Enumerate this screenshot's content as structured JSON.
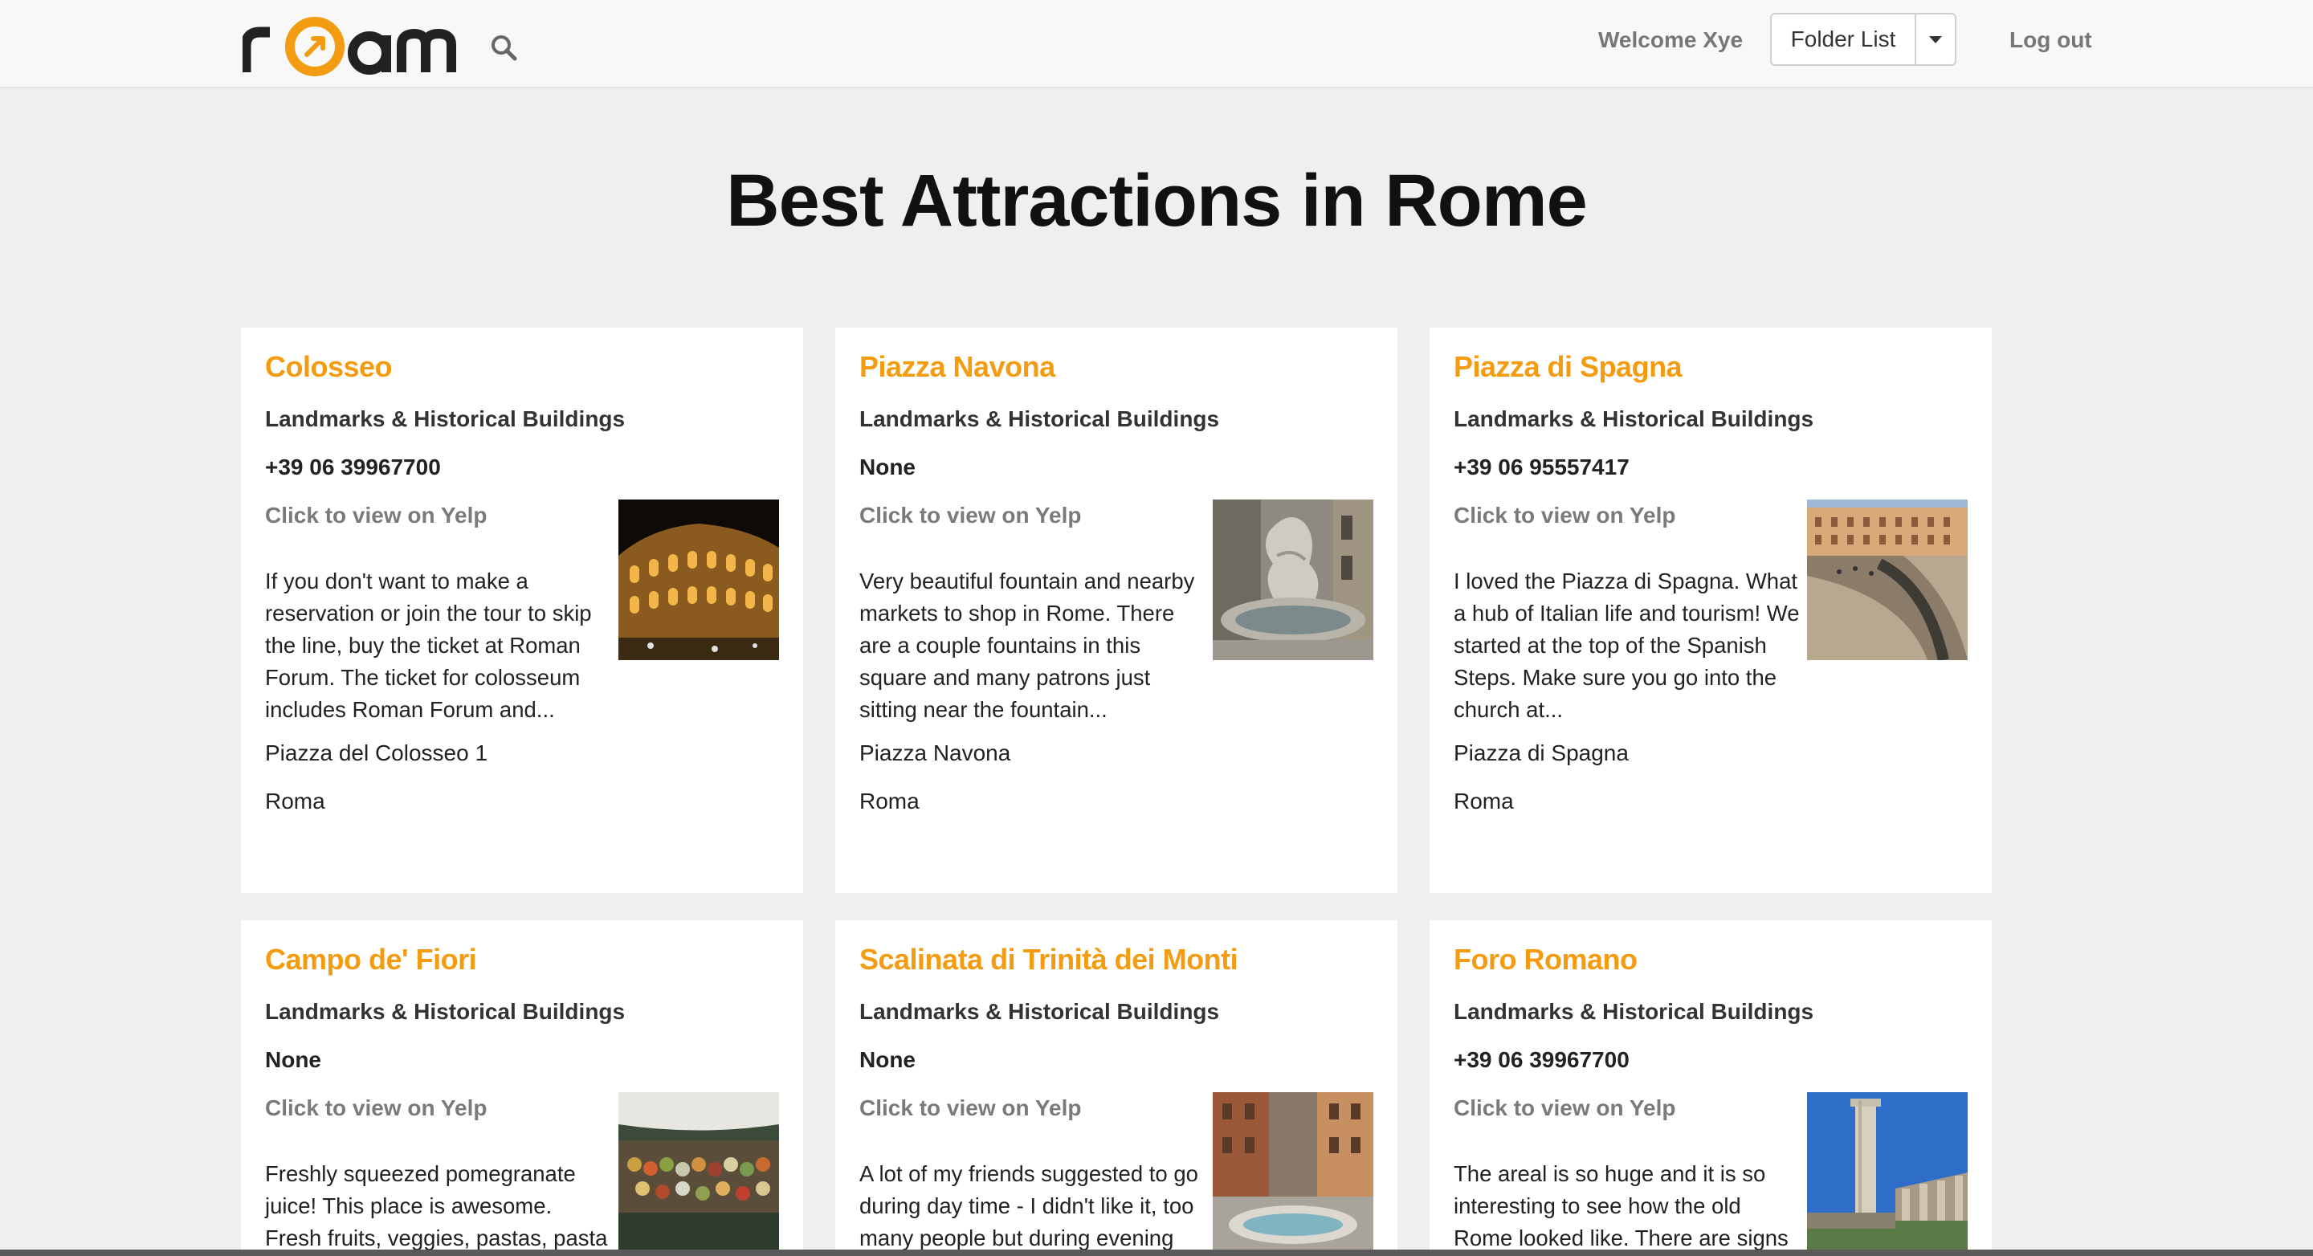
{
  "header": {
    "brand": "roam",
    "welcome": "Welcome Xye",
    "folder_list_label": "Folder List",
    "logout_label": "Log out"
  },
  "page_title": "Best Attractions in Rome",
  "colors": {
    "accent": "#f39c12",
    "background": "#efefef",
    "navbar": "#f8f8f8"
  },
  "cards": [
    {
      "name": "Colosseo",
      "category": "Landmarks & Historical Buildings",
      "phone": "+39 06 39967700",
      "yelp_link": "Click to view on Yelp",
      "review": "If you don't want to make a reservation or join the tour to skip the line, buy the ticket at Roman Forum. The ticket for colosseum includes Roman Forum and...",
      "address": "Piazza del Colosseo 1",
      "city": "Roma",
      "image": "colosseum-photo"
    },
    {
      "name": "Piazza Navona",
      "category": "Landmarks & Historical Buildings",
      "phone": "None",
      "yelp_link": "Click to view on Yelp",
      "review": "Very beautiful fountain and nearby markets to shop in Rome. There are a couple fountains in this square and many patrons just sitting near the fountain...",
      "address": "Piazza Navona",
      "city": "Roma",
      "image": "fountain-statue-photo"
    },
    {
      "name": "Piazza di Spagna",
      "category": "Landmarks & Historical Buildings",
      "phone": "+39 06 95557417",
      "yelp_link": "Click to view on Yelp",
      "review": "I loved the Piazza di Spagna. What a hub of Italian life and tourism! We started at the top of the Spanish Steps. Make sure you go into the church at...",
      "address": "Piazza di Spagna",
      "city": "Roma",
      "image": "piazza-steps-photo"
    },
    {
      "name": "Campo de' Fiori",
      "category": "Landmarks & Historical Buildings",
      "phone": "None",
      "yelp_link": "Click to view on Yelp",
      "review": "Freshly squeezed pomegranate juice! This place is awesome. Fresh fruits, veggies, pastas, pasta sauces,",
      "address": "",
      "city": "",
      "image": "market-stall-photo"
    },
    {
      "name": "Scalinata di Trinità dei Monti",
      "category": "Landmarks & Historical Buildings",
      "phone": "None",
      "yelp_link": "Click to view on Yelp",
      "review": "A lot of my friends suggested to go during day time - I didn't like it, too many people but during evening",
      "address": "",
      "city": "",
      "image": "square-fountain-photo"
    },
    {
      "name": "Foro Romano",
      "category": "Landmarks & Historical Buildings",
      "phone": "+39 06 39967700",
      "yelp_link": "Click to view on Yelp",
      "review": "The areal is so huge and it is so interesting to see how the old Rome looked like. There are signs",
      "address": "",
      "city": "",
      "image": "ruins-column-photo"
    }
  ]
}
